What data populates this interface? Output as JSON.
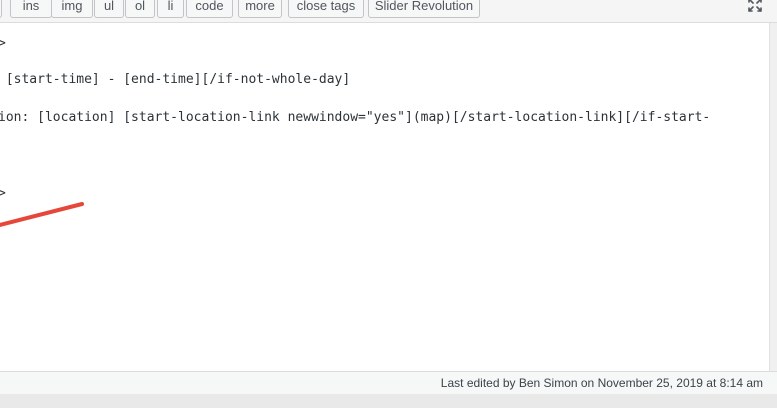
{
  "toolbar": {
    "buttons": {
      "ins": "ins",
      "img": "img",
      "ul": "ul",
      "ol": "ol",
      "li": "li",
      "code": "code",
      "more": "more",
      "close_tags": "close tags",
      "slider_revolution": "Slider Revolution"
    },
    "fullscreen_icon": "fullscreen-icon"
  },
  "editor": {
    "lines": {
      "line1": ">",
      "line2": " [start-time] - [end-time][/if-not-whole-day]",
      "line3": "ion: [location] [start-location-link newwindow=\"yes\"](map)[/start-location-link][/if-start-",
      "line4": ">"
    },
    "annotation_color": "#e5483b"
  },
  "status_bar": {
    "last_edited": "Last edited by Ben Simon on November 25, 2019 at 8:14 am"
  }
}
